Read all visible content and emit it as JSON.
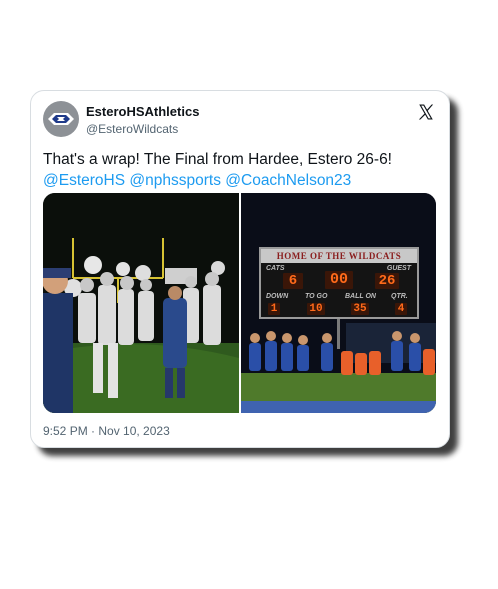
{
  "tweet": {
    "display_name": "EsteroHSAthletics",
    "handle": "@EsteroWildcats",
    "text_line1": "That's a wrap! The Final from Hardee, Estero 26-6!",
    "mentions": [
      "@EsteroHS",
      "@nphssports",
      "@CoachNelson23"
    ],
    "timestamp": "9:52 PM · Nov 10, 2023"
  },
  "scoreboard": {
    "header": "HOME OF THE WILDCATS",
    "home_label": "CATS",
    "guest_label": "GUEST",
    "home_score": "6",
    "clock": "00",
    "guest_score": "26",
    "down_label": "DOWN",
    "to_go_label": "TO GO",
    "ball_on_label": "BALL ON",
    "qtr_label": "QTR.",
    "down": "1",
    "to_go": "10",
    "ball_on": "35",
    "qtr": "4"
  },
  "icons": {
    "x_logo": "x-logo-icon",
    "avatar": "wildcat-logo-icon"
  },
  "colors": {
    "link": "#1d9bf0",
    "text": "#0f1419",
    "muted": "#536471"
  }
}
